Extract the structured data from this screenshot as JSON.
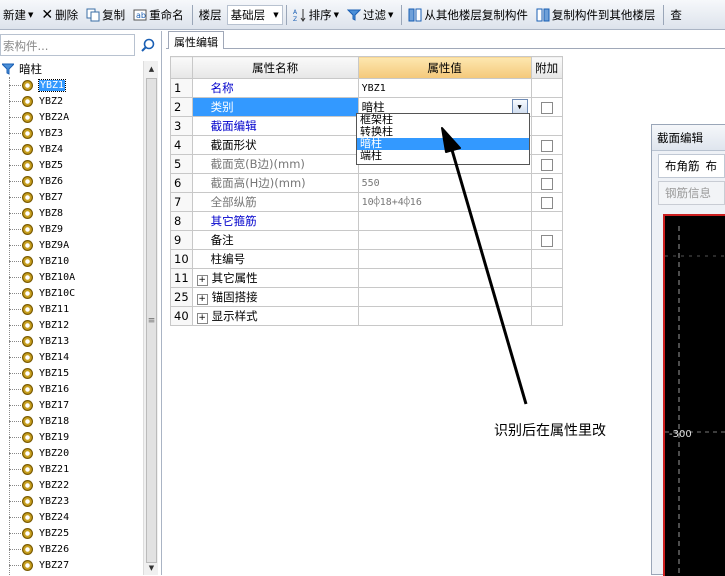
{
  "toolbar": {
    "new_label": "新建",
    "delete_label": "删除",
    "copy_label": "复制",
    "rename_label": "重命名",
    "floor_label": "楼层",
    "floor_value": "基础层",
    "sort_label": "排序",
    "filter_label": "过滤",
    "copy_from_floor_label": "从其他楼层复制构件",
    "copy_to_floor_label": "复制构件到其他楼层",
    "cut_label": "查"
  },
  "sidebar": {
    "search_placeholder": "索构件...",
    "root_label": "暗柱",
    "items": [
      "YBZ1",
      "YBZ2",
      "YBZ2A",
      "YBZ3",
      "YBZ4",
      "YBZ5",
      "YBZ6",
      "YBZ7",
      "YBZ8",
      "YBZ9",
      "YBZ9A",
      "YBZ10",
      "YBZ10A",
      "YBZ10C",
      "YBZ11",
      "YBZ12",
      "YBZ13",
      "YBZ14",
      "YBZ15",
      "YBZ16",
      "YBZ17",
      "YBZ18",
      "YBZ19",
      "YBZ20",
      "YBZ21",
      "YBZ22",
      "YBZ23",
      "YBZ24",
      "YBZ25",
      "YBZ26",
      "YBZ27"
    ],
    "selected_index": 0
  },
  "properties": {
    "tab_label": "属性编辑",
    "headers": {
      "name": "属性名称",
      "value": "属性值",
      "extra": "附加"
    },
    "rows": [
      {
        "num": "1",
        "name": "名称",
        "value": "YBZ1",
        "checkbox": false,
        "style": "blue"
      },
      {
        "num": "2",
        "name": "类别",
        "value": "暗柱",
        "checkbox": true,
        "style": "selected"
      },
      {
        "num": "3",
        "name": "截面编辑",
        "value": "",
        "checkbox": false,
        "style": "blue"
      },
      {
        "num": "4",
        "name": "截面形状",
        "value": "",
        "checkbox": true,
        "style": ""
      },
      {
        "num": "5",
        "name": "截面宽(B边)(mm)",
        "value": "",
        "checkbox": true,
        "style": "gray"
      },
      {
        "num": "6",
        "name": "截面高(H边)(mm)",
        "value": "550",
        "checkbox": true,
        "style": "gray"
      },
      {
        "num": "7",
        "name": "全部纵筋",
        "value": "10⌽18+4⌽16",
        "checkbox": true,
        "style": "gray"
      },
      {
        "num": "8",
        "name": "其它箍筋",
        "value": "",
        "checkbox": false,
        "style": "blue"
      },
      {
        "num": "9",
        "name": "备注",
        "value": "",
        "checkbox": true,
        "style": ""
      },
      {
        "num": "10",
        "name": "柱编号",
        "value": "",
        "checkbox": false,
        "style": ""
      },
      {
        "num": "11",
        "name": "其它属性",
        "value": "",
        "checkbox": false,
        "style": "group"
      },
      {
        "num": "25",
        "name": "锚固搭接",
        "value": "",
        "checkbox": false,
        "style": "group"
      },
      {
        "num": "40",
        "name": "显示样式",
        "value": "",
        "checkbox": false,
        "style": "group"
      }
    ],
    "category_dropdown": {
      "current": "暗柱",
      "options": [
        "框架柱",
        "转换柱",
        "暗柱",
        "端柱"
      ],
      "selected_index": 2
    }
  },
  "section_editor": {
    "title": "截面编辑",
    "rebar_button": "布角筋",
    "rebar_button_extra": "布",
    "rebar_info_button": "钢筋信息",
    "canvas_label": "-300"
  },
  "annotation": {
    "text": "识别后在属性里改"
  },
  "colors": {
    "selection": "#3399ff",
    "header_value": "#f4c87a",
    "link_blue": "#0000cc",
    "canvas_bg": "#000000"
  }
}
